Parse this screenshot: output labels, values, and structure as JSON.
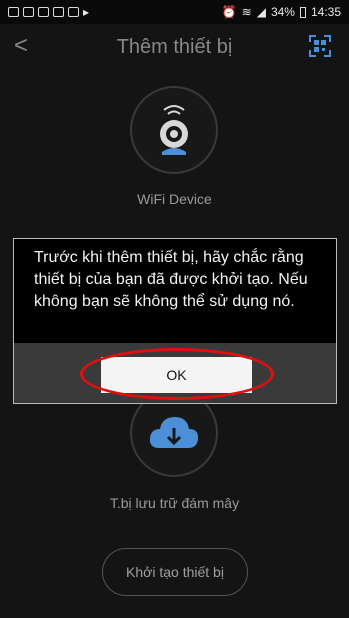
{
  "status_bar": {
    "battery": "34%",
    "time": "14:35"
  },
  "header": {
    "title": "Thêm thiết bị",
    "back_glyph": "<"
  },
  "options": [
    {
      "label": "WiFi Device",
      "icon": "wifi-camera-icon"
    },
    {
      "label": "T.bị lưu trữ đám mây",
      "icon": "cloud-download-icon"
    }
  ],
  "init_button": {
    "label": "Khởi tạo thiết bị"
  },
  "dialog": {
    "message": "Trước khi thêm thiết bị, hãy chắc rằng thiết bị của bạn đã được khởi tạo. Nếu không bạn sẽ không thể sử dụng nó.",
    "ok_label": "OK"
  },
  "colors": {
    "accent_blue": "#4d8fd6",
    "highlight_red": "#e01010",
    "background": "#141414"
  }
}
